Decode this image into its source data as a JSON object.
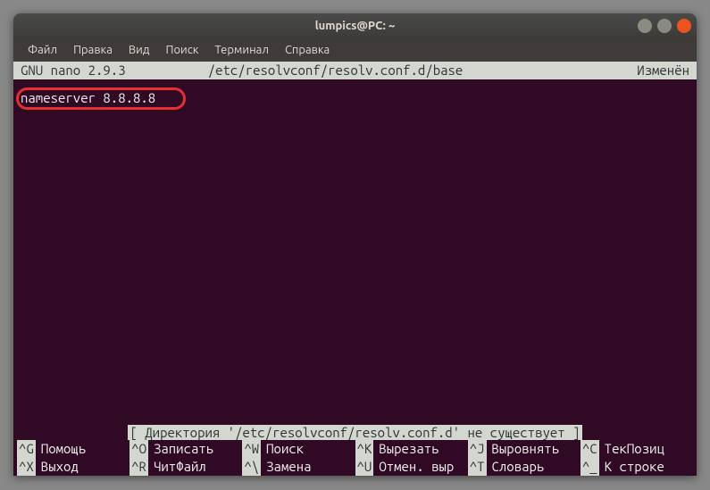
{
  "titlebar": {
    "title": "lumpics@PC: ~"
  },
  "menu": {
    "file": "Файл",
    "edit": "Правка",
    "view": "Вид",
    "search": "Поиск",
    "terminal": "Терминал",
    "help": "Справка"
  },
  "nano": {
    "version": "GNU nano  2.9.3",
    "filepath": "/etc/resolvconf/resolv.conf.d/base",
    "status": "Изменён",
    "content": "nameserver 8.8.8.8",
    "message": "[ Директория '/etc/resolvconf/resolv.conf.d' не существует ]"
  },
  "shortcuts": {
    "row1": [
      {
        "key": "^G",
        "desc": "Помощь"
      },
      {
        "key": "^O",
        "desc": "Записать"
      },
      {
        "key": "^W",
        "desc": "Поиск"
      },
      {
        "key": "^K",
        "desc": "Вырезать"
      },
      {
        "key": "^J",
        "desc": "Выровнять"
      },
      {
        "key": "^C",
        "desc": "ТекПозиц"
      }
    ],
    "row2": [
      {
        "key": "^X",
        "desc": "Выход"
      },
      {
        "key": "^R",
        "desc": "ЧитФайл"
      },
      {
        "key": "^\\",
        "desc": "Замена"
      },
      {
        "key": "^U",
        "desc": "Отмен. выр"
      },
      {
        "key": "^T",
        "desc": "Словарь"
      },
      {
        "key": "^_",
        "desc": "К строке"
      }
    ]
  }
}
